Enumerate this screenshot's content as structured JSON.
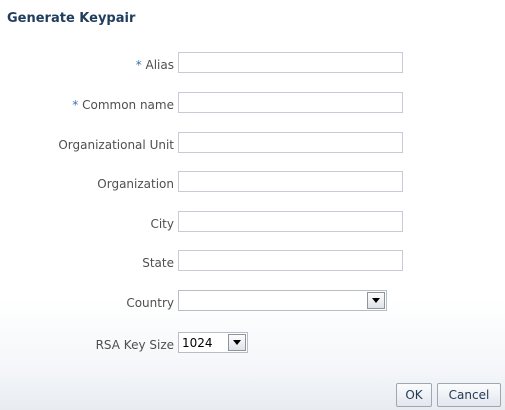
{
  "dialog": {
    "title": "Generate Keypair"
  },
  "fields": [
    {
      "label": "Alias",
      "required_mark": "*",
      "value": ""
    },
    {
      "label": "Common name",
      "required_mark": "*",
      "value": ""
    },
    {
      "label": "Organizational Unit",
      "required_mark": "",
      "value": ""
    },
    {
      "label": "Organization",
      "required_mark": "",
      "value": ""
    },
    {
      "label": "City",
      "required_mark": "",
      "value": ""
    },
    {
      "label": "State",
      "required_mark": "",
      "value": ""
    }
  ],
  "country": {
    "label": "Country",
    "value": ""
  },
  "rsa_key_size": {
    "label": "RSA Key Size",
    "value": "1024"
  },
  "buttons": {
    "ok": "OK",
    "cancel": "Cancel"
  },
  "colors": {
    "title": "#1f3d5c",
    "required_mark": "#3b6fb6",
    "label": "#4f4f4f"
  },
  "icons": {
    "dropdown": "chevron-down-icon"
  }
}
